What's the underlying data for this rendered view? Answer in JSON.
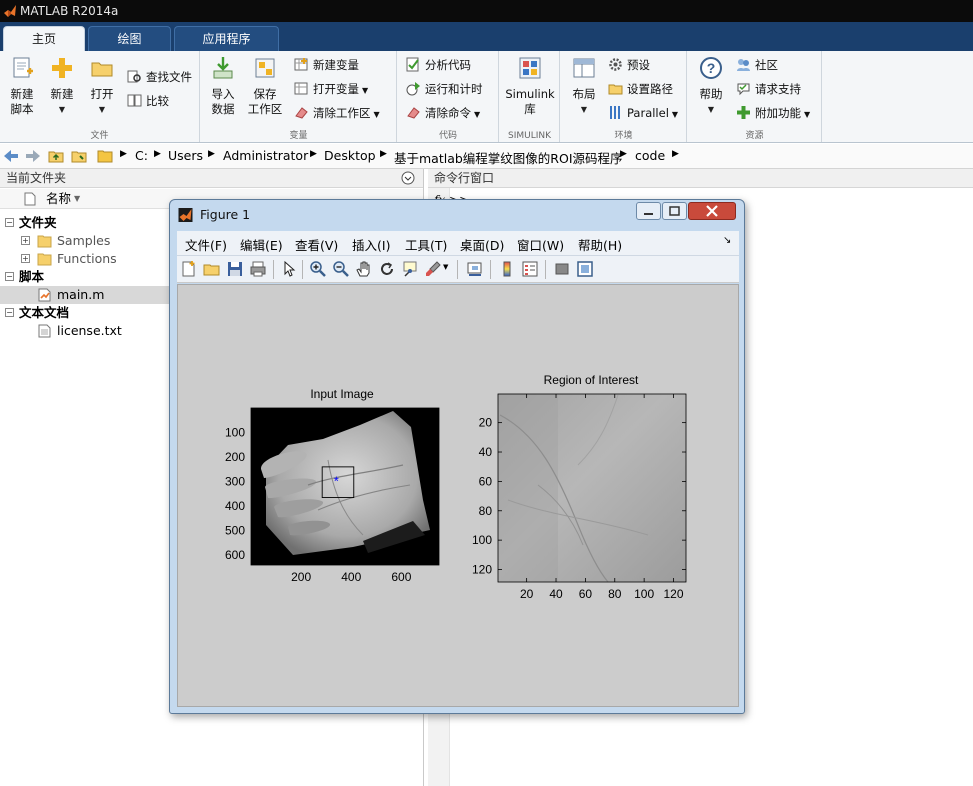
{
  "app": {
    "title": "MATLAB R2014a"
  },
  "tabs": [
    {
      "label": "主页"
    },
    {
      "label": "绘图"
    },
    {
      "label": "应用程序"
    }
  ],
  "ribbon": {
    "file": {
      "section_label": "文件",
      "new_script": "新建\n脚本",
      "new": "新建",
      "open": "打开",
      "find_files": "查找文件",
      "compare": "比较"
    },
    "variable": {
      "section_label": "变量",
      "import_data": "导入\n数据",
      "save_workspace": "保存\n工作区",
      "new_variable": "新建变量",
      "open_variable": "打开变量",
      "clear_workspace": "清除工作区"
    },
    "code": {
      "section_label": "代码",
      "analyze_code": "分析代码",
      "run_and_time": "运行和计时",
      "clear_commands": "清除命令"
    },
    "simulink": {
      "section_label": "SIMULINK",
      "library": "Simulink\n库"
    },
    "environment": {
      "section_label": "环境",
      "layout": "布局",
      "preferences": "预设",
      "set_path": "设置路径",
      "parallel": "Parallel"
    },
    "resources": {
      "section_label": "资源",
      "help": "帮助",
      "community": "社区",
      "request_support": "请求支持",
      "addons": "附加功能"
    }
  },
  "address": {
    "crumbs": [
      "C:",
      "Users",
      "Administrator",
      "Desktop",
      "基于matlab编程掌纹图像的ROI源码程序",
      "code"
    ]
  },
  "current_folder": {
    "title": "当前文件夹",
    "column_name": "名称",
    "groups": [
      {
        "label": "文件夹",
        "items": [
          "Samples",
          "Functions"
        ]
      },
      {
        "label": "脚本",
        "items": [
          "main.m"
        ]
      },
      {
        "label": "文本文档",
        "items": [
          "license.txt"
        ]
      }
    ]
  },
  "command_window": {
    "title": "命令行窗口",
    "prompt": "fx >>"
  },
  "figure": {
    "title": "Figure 1",
    "menu": [
      "文件(F)",
      "编辑(E)",
      "查看(V)",
      "插入(I)",
      "工具(T)",
      "桌面(D)",
      "窗口(W)",
      "帮助(H)"
    ],
    "menu_overflow": "↘",
    "toolbar_icons": [
      "new-figure-icon",
      "open-file-icon",
      "save-icon",
      "print-icon",
      "edit-plot-arrow-icon",
      "zoom-in-icon",
      "zoom-out-icon",
      "pan-hand-icon",
      "rotate-3d-icon",
      "data-cursor-icon",
      "brush-icon",
      "link-plot-icon",
      "colorbar-icon",
      "legend-icon",
      "hide-plot-tools-icon",
      "show-plot-tools-icon"
    ]
  },
  "chart_data": [
    {
      "type": "image",
      "title": "Input Image",
      "xlabel": "",
      "ylabel": "",
      "xticks": [
        200,
        400,
        600
      ],
      "yticks": [
        100,
        200,
        300,
        400,
        500,
        600
      ],
      "xlim": [
        0,
        750
      ],
      "ylim": [
        0,
        640
      ],
      "roi_box": {
        "x": [
          284,
          410
        ],
        "y": [
          240,
          365
        ]
      },
      "marker": {
        "x": 340,
        "y": 300,
        "symbol": "*",
        "color": "#0000ff"
      }
    },
    {
      "type": "image",
      "title": "Region of Interest",
      "xlabel": "",
      "ylabel": "",
      "xticks": [
        20,
        40,
        60,
        80,
        100,
        120
      ],
      "yticks": [
        20,
        40,
        60,
        80,
        100,
        120
      ],
      "xlim": [
        0.5,
        128.5
      ],
      "ylim": [
        0.5,
        128.5
      ]
    }
  ]
}
